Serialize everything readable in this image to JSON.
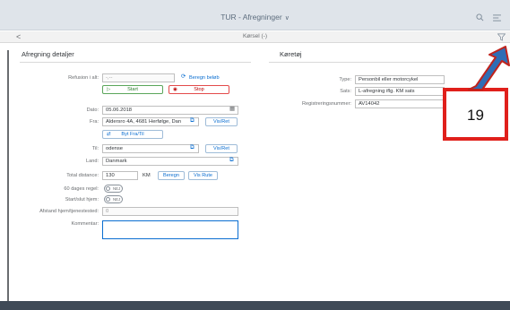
{
  "shell": {
    "title": "TUR - Afregninger",
    "title_chevron": "∨"
  },
  "subbar": {
    "back": "<",
    "title": "Kørsel (-)"
  },
  "left": {
    "section_title": "Afregning detaljer",
    "refusion_label": "Refusion i alt:",
    "refusion_value": "-,--",
    "beregn_beloeb": "Beregn beløb",
    "start_label": "Start",
    "stop_label": "Stop",
    "dato_label": "Dato:",
    "dato_value": "05.06.2018",
    "fra_label": "Fra:",
    "fra_value": "Aldersro 4A, 4681 Herfølge, Dan",
    "vis_ret_label": "Vis/Ret",
    "byt_label": "Byt Fra/Til",
    "til_label": "Til:",
    "til_value": "odense",
    "land_label": "Land:",
    "land_value": "Danmark",
    "total_label": "Total distance:",
    "total_value": "130",
    "unit": "KM",
    "beregn_label": "Beregn",
    "vis_rute_label": "Vis Rute",
    "regel_label": "60 dages regel:",
    "start_slut_label": "Start/slut hjem:",
    "nej": "NEJ",
    "afstand_label": "Afstand hjem/tjenestested:",
    "afstand_value": "0",
    "kommentar_label": "Kommentar:"
  },
  "right": {
    "section_title": "Køretøj",
    "type_label": "Type:",
    "type_value": "Personbil eller motorcykel",
    "sats_label": "Sats:",
    "sats_value": "L-afregning iflg. KM sats",
    "reg_label": "Registreringsnummer:",
    "reg_value": "AV14042"
  },
  "callout": {
    "number": "19"
  },
  "colors": {
    "accent": "#0a6ed1",
    "callout_red": "#e0201b",
    "arrow_blue": "#2f6db5"
  }
}
